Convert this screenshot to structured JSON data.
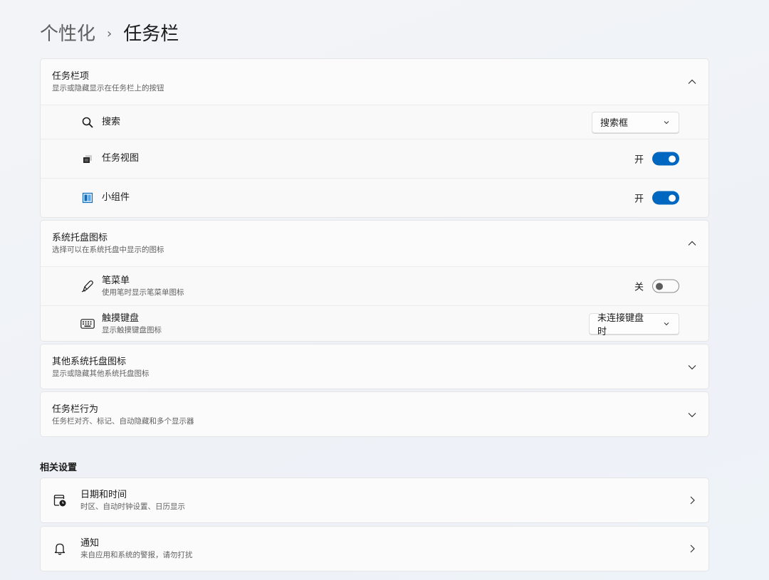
{
  "breadcrumb": {
    "parent": "个性化",
    "separator": "›",
    "current": "任务栏"
  },
  "taskbar_items": {
    "title": "任务栏项",
    "subtitle": "显示或隐藏显示在任务栏上的按钮",
    "expanded": true,
    "rows": [
      {
        "label": "搜索",
        "icon": "search-icon",
        "control": "dropdown",
        "value": "搜索框"
      },
      {
        "label": "任务视图",
        "icon": "task-view-icon",
        "control": "toggle",
        "state_label": "开",
        "on": true
      },
      {
        "label": "小组件",
        "icon": "widgets-icon",
        "control": "toggle",
        "state_label": "开",
        "on": true
      }
    ]
  },
  "system_tray": {
    "title": "系统托盘图标",
    "subtitle": "选择可以在系统托盘中显示的图标",
    "expanded": true,
    "rows": [
      {
        "label": "笔菜单",
        "sub": "使用笔时显示笔菜单图标",
        "icon": "pen-icon",
        "control": "toggle",
        "state_label": "关",
        "on": false
      },
      {
        "label": "触摸键盘",
        "sub": "显示触摸键盘图标",
        "icon": "keyboard-icon",
        "control": "dropdown",
        "value": "未连接键盘时"
      }
    ]
  },
  "other_tray": {
    "title": "其他系统托盘图标",
    "subtitle": "显示或隐藏其他系统托盘图标",
    "expanded": false
  },
  "behaviors": {
    "title": "任务栏行为",
    "subtitle": "任务栏对齐、标记、自动隐藏和多个显示器",
    "expanded": false
  },
  "related": {
    "heading": "相关设置",
    "items": [
      {
        "title": "日期和时间",
        "subtitle": "时区、自动时钟设置、日历显示",
        "icon": "calendar-clock-icon"
      },
      {
        "title": "通知",
        "subtitle": "来自应用和系统的警报，请勿打扰",
        "icon": "bell-icon"
      }
    ]
  },
  "colors": {
    "accent": "#0067c0",
    "background": "#f3f4f7",
    "card": "#fbfbfb"
  }
}
